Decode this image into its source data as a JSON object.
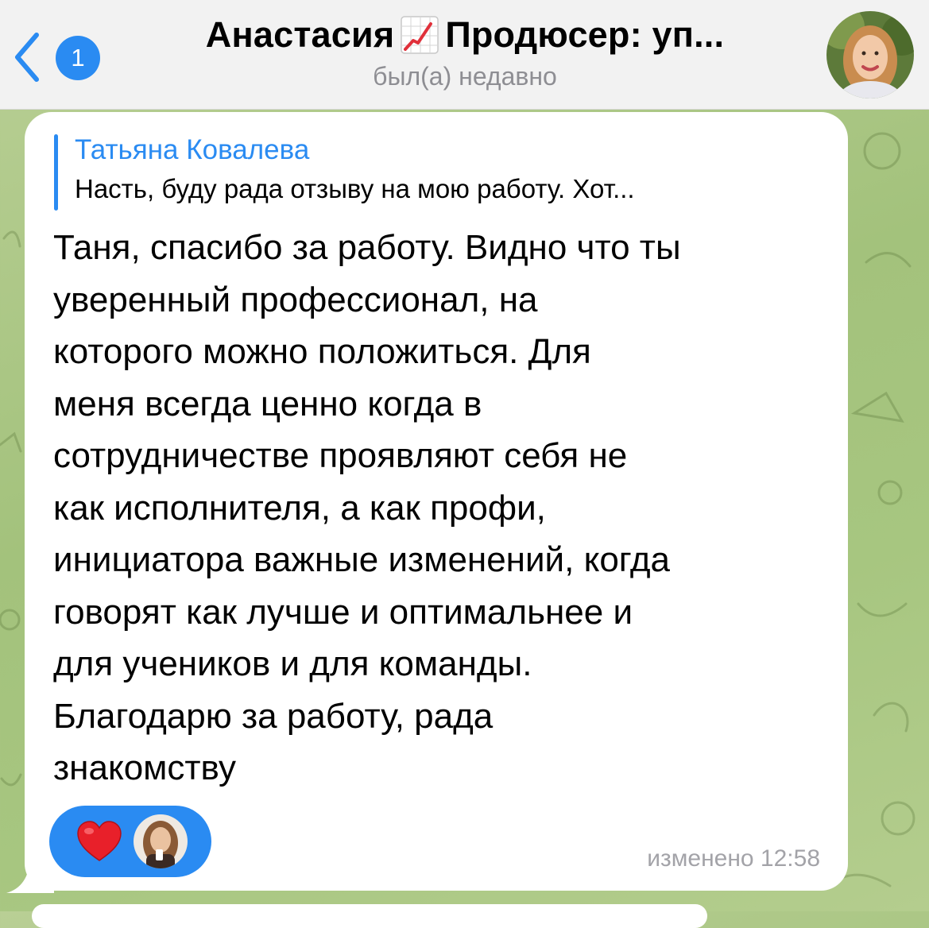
{
  "header": {
    "back_badge": "1",
    "title_before_icon": "Анастасия",
    "title_icon": "chart-increasing-icon",
    "title_after_icon": "Продюсер: уп...",
    "status": "был(а) недавно"
  },
  "message": {
    "reply": {
      "author": "Татьяна Ковалева",
      "text": "Насть, буду рада отзыву на мою работу. Хот..."
    },
    "body": "Таня, спасибо за работу. Видно что ты\nуверенный профессионал, на\nкоторого можно положиться. Для\nменя всегда ценно когда в\nсотрудничестве проявляют себя не\nкак исполнителя, а как профи,\nинициатора важные изменений, когда\nговорят как лучше и оптимальнее и\nдля учеников и для команды.\nБлагодарю за работу, рада\nзнакомству",
    "reactions": [
      {
        "emoji": "heart-icon"
      }
    ],
    "meta": "изменено 12:58"
  },
  "colors": {
    "accent": "#2a8bf2",
    "header_bg": "#f2f2f2",
    "bubble_bg": "#ffffff",
    "meta_text": "#a3a3a8",
    "heart": "#e8202a"
  }
}
